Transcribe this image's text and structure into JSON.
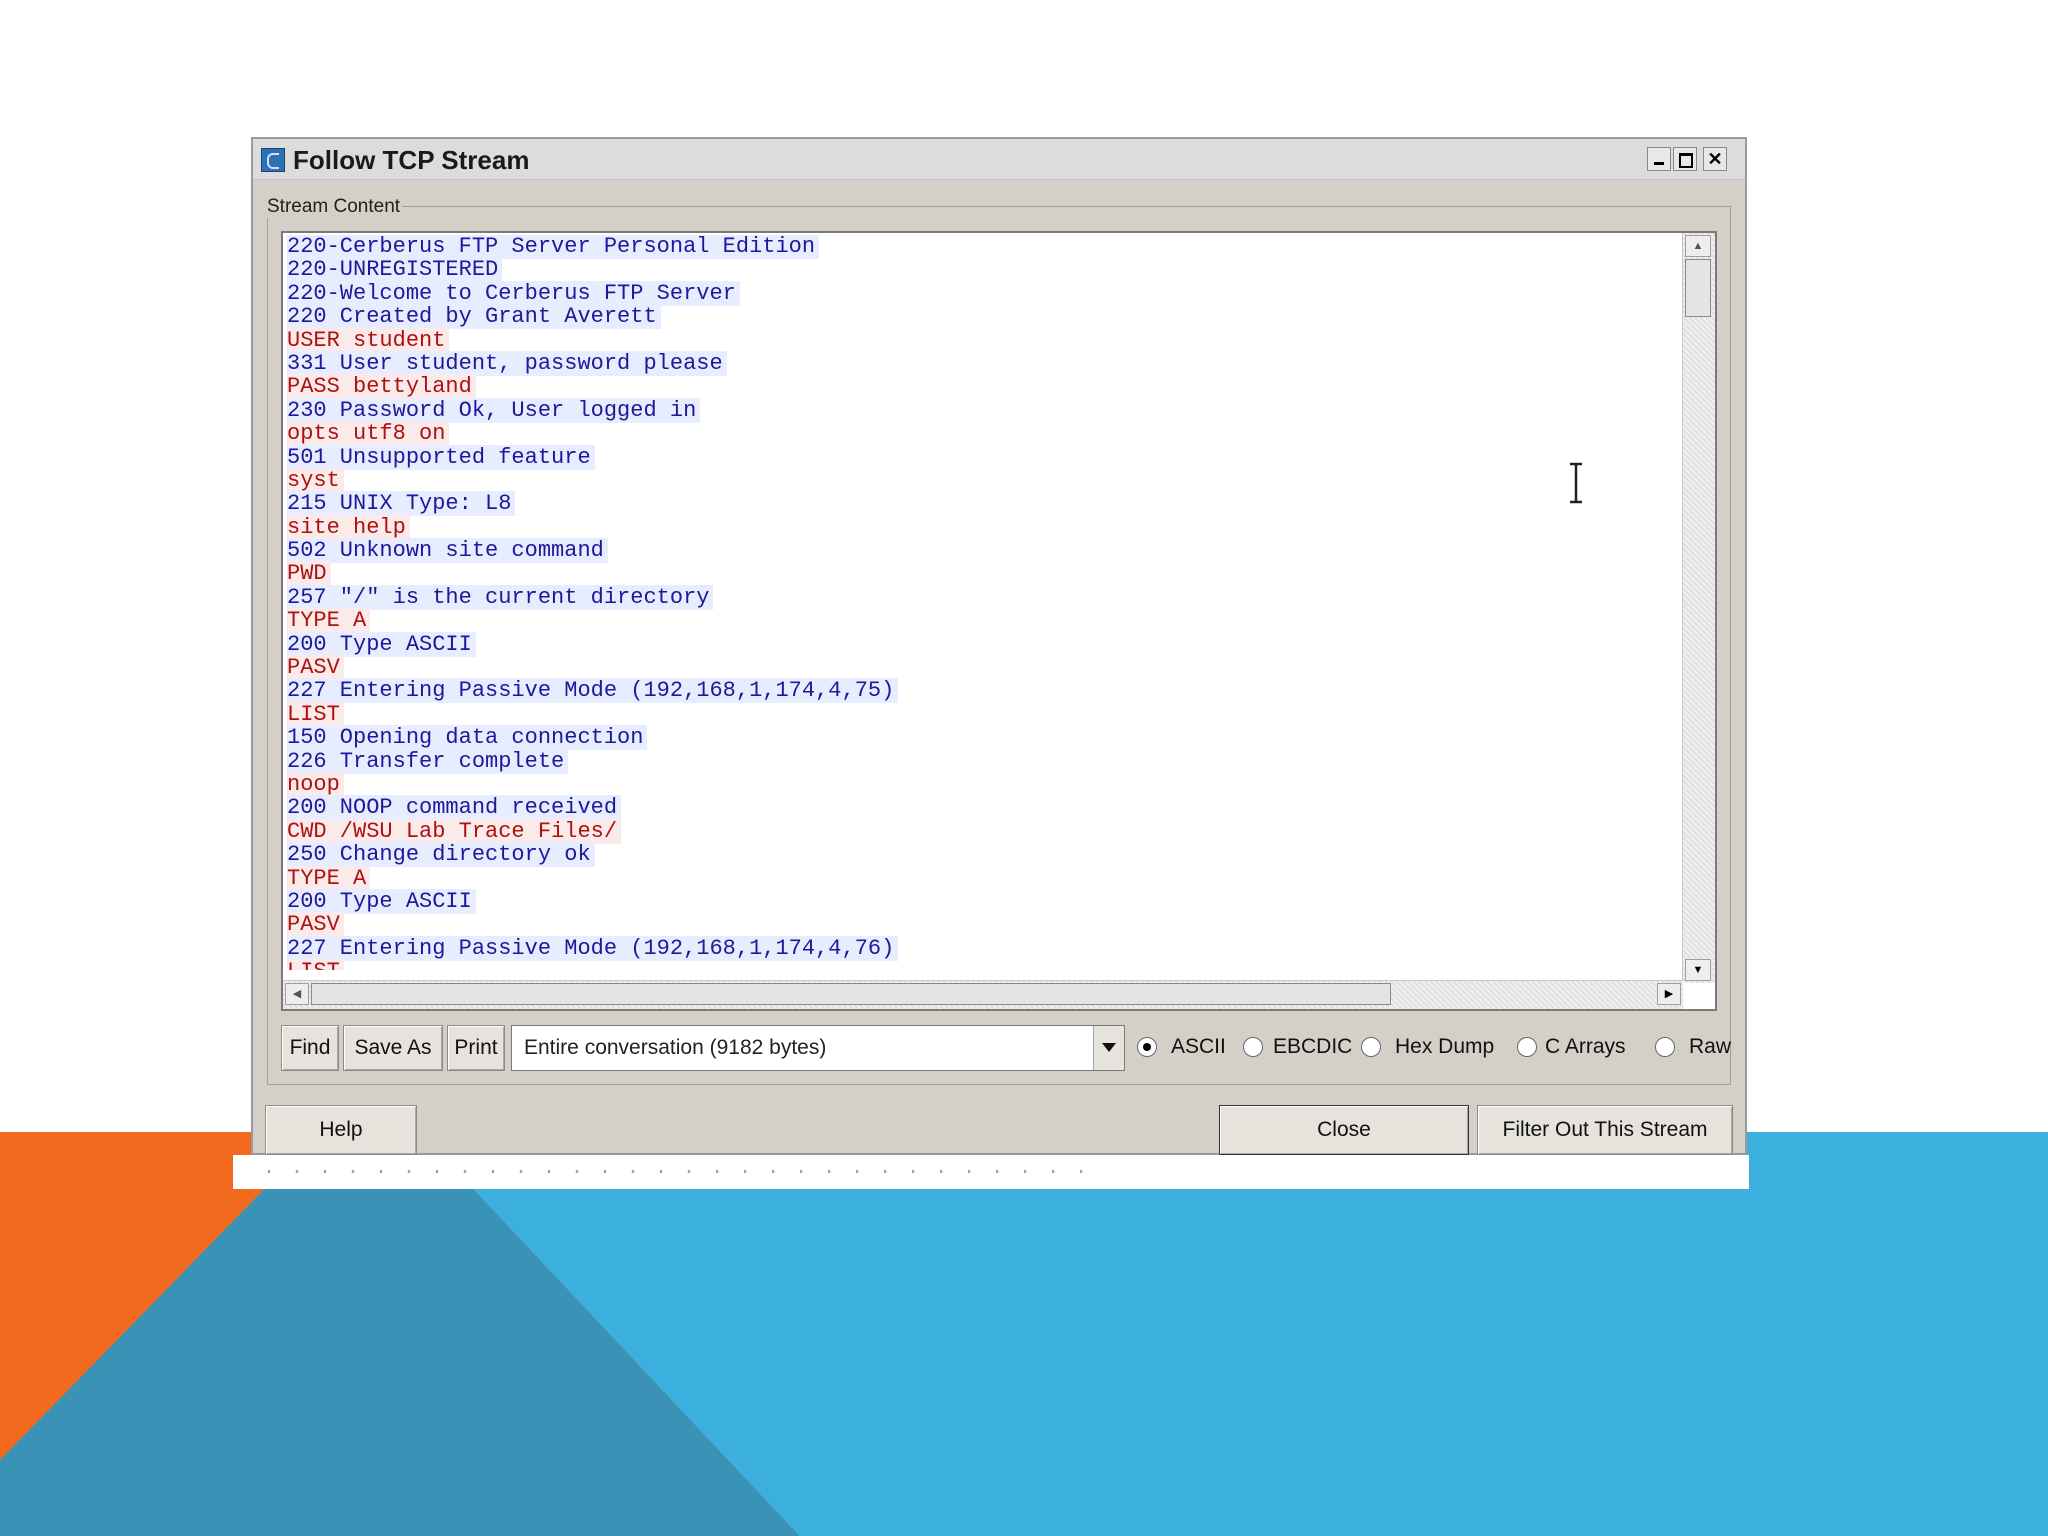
{
  "slide": {
    "colors": {
      "orange": "#f26a1e",
      "blue": "#3bb0df",
      "teal": "#3a93b6",
      "white": "#ffffff"
    }
  },
  "window": {
    "title": "Follow TCP Stream",
    "icon": "wireshark-app-icon",
    "controls": [
      "minimize-icon",
      "maximize-icon",
      "close-icon"
    ]
  },
  "stream_group": {
    "legend": "Stream Content"
  },
  "stream_lines": [
    {
      "dir": "server",
      "text": "220-Cerberus FTP Server Personal Edition"
    },
    {
      "dir": "server",
      "text": "220-UNREGISTERED"
    },
    {
      "dir": "server",
      "text": "220-Welcome to Cerberus FTP Server"
    },
    {
      "dir": "server",
      "text": "220 Created by Grant Averett"
    },
    {
      "dir": "client",
      "text": "USER student"
    },
    {
      "dir": "server",
      "text": "331 User student, password please"
    },
    {
      "dir": "client",
      "text": "PASS bettyland"
    },
    {
      "dir": "server",
      "text": "230 Password Ok, User logged in"
    },
    {
      "dir": "client",
      "text": "opts utf8 on"
    },
    {
      "dir": "server",
      "text": "501 Unsupported feature"
    },
    {
      "dir": "client",
      "text": "syst"
    },
    {
      "dir": "server",
      "text": "215 UNIX Type: L8"
    },
    {
      "dir": "client",
      "text": "site help"
    },
    {
      "dir": "server",
      "text": "502 Unknown site command"
    },
    {
      "dir": "client",
      "text": "PWD"
    },
    {
      "dir": "server",
      "text": "257 \"/\" is the current directory"
    },
    {
      "dir": "client",
      "text": "TYPE A"
    },
    {
      "dir": "server",
      "text": "200 Type ASCII"
    },
    {
      "dir": "client",
      "text": "PASV"
    },
    {
      "dir": "server",
      "text": "227 Entering Passive Mode (192,168,1,174,4,75)"
    },
    {
      "dir": "client",
      "text": "LIST"
    },
    {
      "dir": "server",
      "text": "150 Opening data connection"
    },
    {
      "dir": "server",
      "text": "226 Transfer complete"
    },
    {
      "dir": "client",
      "text": "noop"
    },
    {
      "dir": "server",
      "text": "200 NOOP command received"
    },
    {
      "dir": "client",
      "text": "CWD /WSU Lab Trace Files/"
    },
    {
      "dir": "server",
      "text": "250 Change directory ok"
    },
    {
      "dir": "client",
      "text": "TYPE A"
    },
    {
      "dir": "server",
      "text": "200 Type ASCII"
    },
    {
      "dir": "client",
      "text": "PASV"
    },
    {
      "dir": "server",
      "text": "227 Entering Passive Mode (192,168,1,174,4,76)"
    },
    {
      "dir": "client",
      "text": "LIST"
    }
  ],
  "stream_colors": {
    "server_text": "#1a1a9a",
    "server_bg": "#e8ecff",
    "client_text": "#b01010",
    "client_bg": "#fbeaea"
  },
  "toolbar": {
    "find_label": "Find",
    "save_as_label": "Save As",
    "print_label": "Print",
    "conversation_select": {
      "selected": "Entire conversation (9182 bytes)"
    },
    "format_options": [
      {
        "label": "ASCII",
        "checked": true
      },
      {
        "label": "EBCDIC",
        "checked": false
      },
      {
        "label": "Hex Dump",
        "checked": false
      },
      {
        "label": "C Arrays",
        "checked": false
      },
      {
        "label": "Raw",
        "checked": false
      }
    ]
  },
  "footer": {
    "help_label": "Help",
    "close_label": "Close",
    "filter_label": "Filter Out This Stream"
  },
  "cursor": "text-cursor-icon"
}
